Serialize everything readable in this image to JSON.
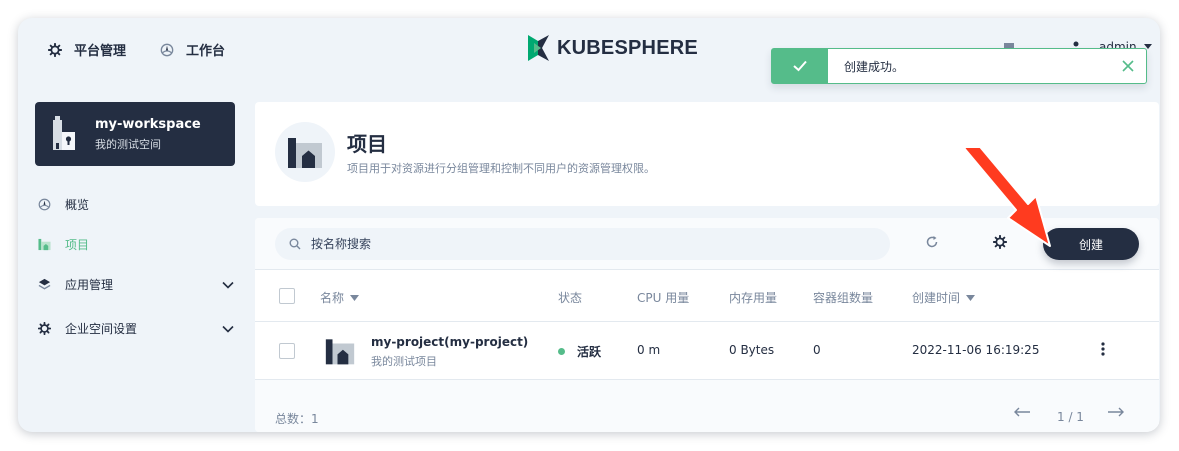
{
  "topnav": {
    "platform_label": "平台管理",
    "workbench_label": "工作台",
    "brand": "KUBESPHERE",
    "user": "admin"
  },
  "toast": {
    "message": "创建成功。"
  },
  "workspace": {
    "name": "my-workspace",
    "description": "我的测试空间"
  },
  "sidebar": {
    "items": [
      {
        "label": "概览",
        "icon": "dashboard-icon"
      },
      {
        "label": "项目",
        "icon": "project-icon",
        "active": true
      },
      {
        "label": "应用管理",
        "icon": "layers-icon",
        "expandable": true
      },
      {
        "label": "企业空间设置",
        "icon": "gear-icon",
        "expandable": true
      }
    ]
  },
  "header": {
    "title": "项目",
    "description": "项目用于对资源进行分组管理和控制不同用户的资源管理权限。"
  },
  "toolbar": {
    "search_placeholder": "按名称搜索",
    "create_label": "创建"
  },
  "table": {
    "columns": [
      "名称",
      "状态",
      "CPU 用量",
      "内存用量",
      "容器组数量",
      "创建时间"
    ],
    "rows": [
      {
        "name": "my-project(my-project)",
        "description": "我的测试项目",
        "status": "活跃",
        "cpu": "0 m",
        "memory": "0 Bytes",
        "pods": "0",
        "created": "2022-11-06 16:19:25"
      }
    ]
  },
  "footer": {
    "total": "总数：1",
    "page": "1 / 1"
  },
  "colors": {
    "accent_green": "#55bc8a",
    "dark": "#242e42",
    "background": "#eff4f9",
    "annotation_red": "#ff3b1f"
  }
}
